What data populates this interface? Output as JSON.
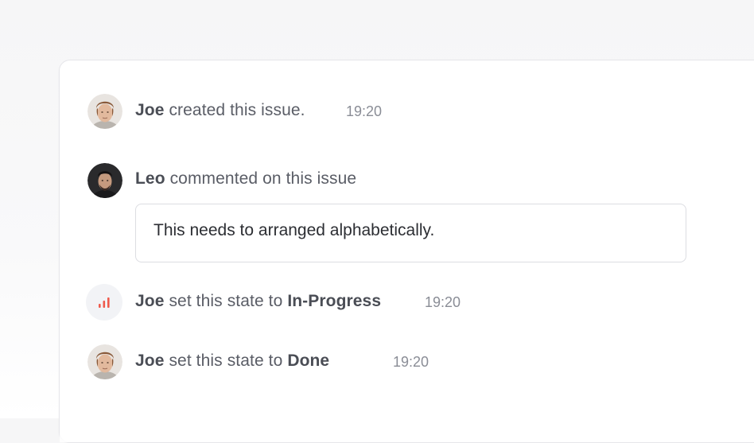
{
  "activity": [
    {
      "user": "Joe",
      "text": "created this issue.",
      "time": "19:20"
    },
    {
      "user": "Leo",
      "text": "commented on this issue",
      "comment": "This needs to arranged alphabetically."
    },
    {
      "user": "Joe",
      "text": "set this state to",
      "state": "In-Progress",
      "time": "19:20"
    },
    {
      "user": "Joe",
      "text": "set this state to",
      "state": "Done",
      "time": "19:20"
    }
  ],
  "icons": {
    "state_icon": "signal-bars-icon",
    "state_icon_color": "#ef5a4c"
  }
}
